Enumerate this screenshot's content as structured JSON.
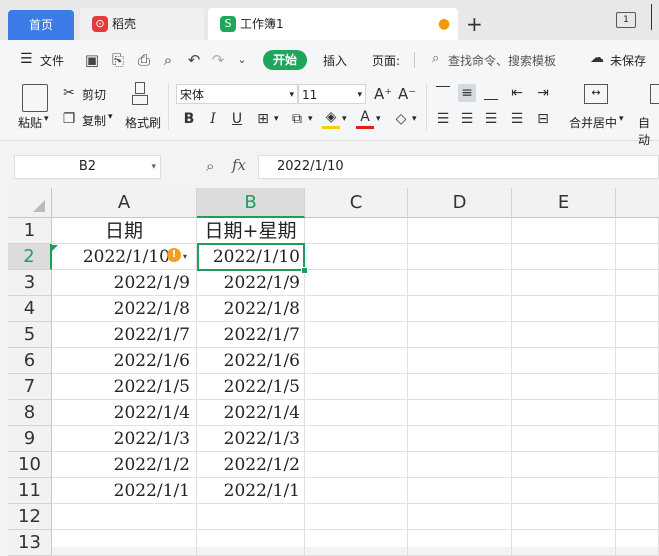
{
  "tabs": {
    "home": "首页",
    "daoke": "稻壳",
    "workbook": "工作簿1",
    "add": "+"
  },
  "menu": {
    "file": "文件",
    "start": "开始",
    "insert": "插入",
    "page": "页面:",
    "search_placeholder": "查找命令、搜索模板",
    "unsaved": "未保存"
  },
  "ribbon": {
    "paste": "粘贴",
    "cut": "剪切",
    "copy": "复制",
    "format_painter": "格式刷",
    "font_name": "宋体",
    "font_size": "11",
    "merge_center": "合并居中",
    "auto_wrap": "自动"
  },
  "formula_bar": {
    "name_box": "B2",
    "fx": "fx",
    "value": "2022/1/10"
  },
  "columns": [
    "A",
    "B",
    "C",
    "D",
    "E"
  ],
  "rows": [
    "1",
    "2",
    "3",
    "4",
    "5",
    "6",
    "7",
    "8",
    "9",
    "10",
    "11",
    "12",
    "13"
  ],
  "cells": {
    "A": [
      "日期",
      "2022/1/10",
      "2022/1/9",
      "2022/1/8",
      "2022/1/7",
      "2022/1/6",
      "2022/1/5",
      "2022/1/4",
      "2022/1/3",
      "2022/1/2",
      "2022/1/1"
    ],
    "B": [
      "日期+星期",
      "2022/1/10",
      "2022/1/9",
      "2022/1/8",
      "2022/1/7",
      "2022/1/6",
      "2022/1/5",
      "2022/1/4",
      "2022/1/3",
      "2022/1/2",
      "2022/1/1"
    ]
  },
  "active_cell": "B2",
  "colors": {
    "accent_green": "#1d9e5d",
    "home_tab": "#3d7be8",
    "warn": "#f0a020"
  }
}
